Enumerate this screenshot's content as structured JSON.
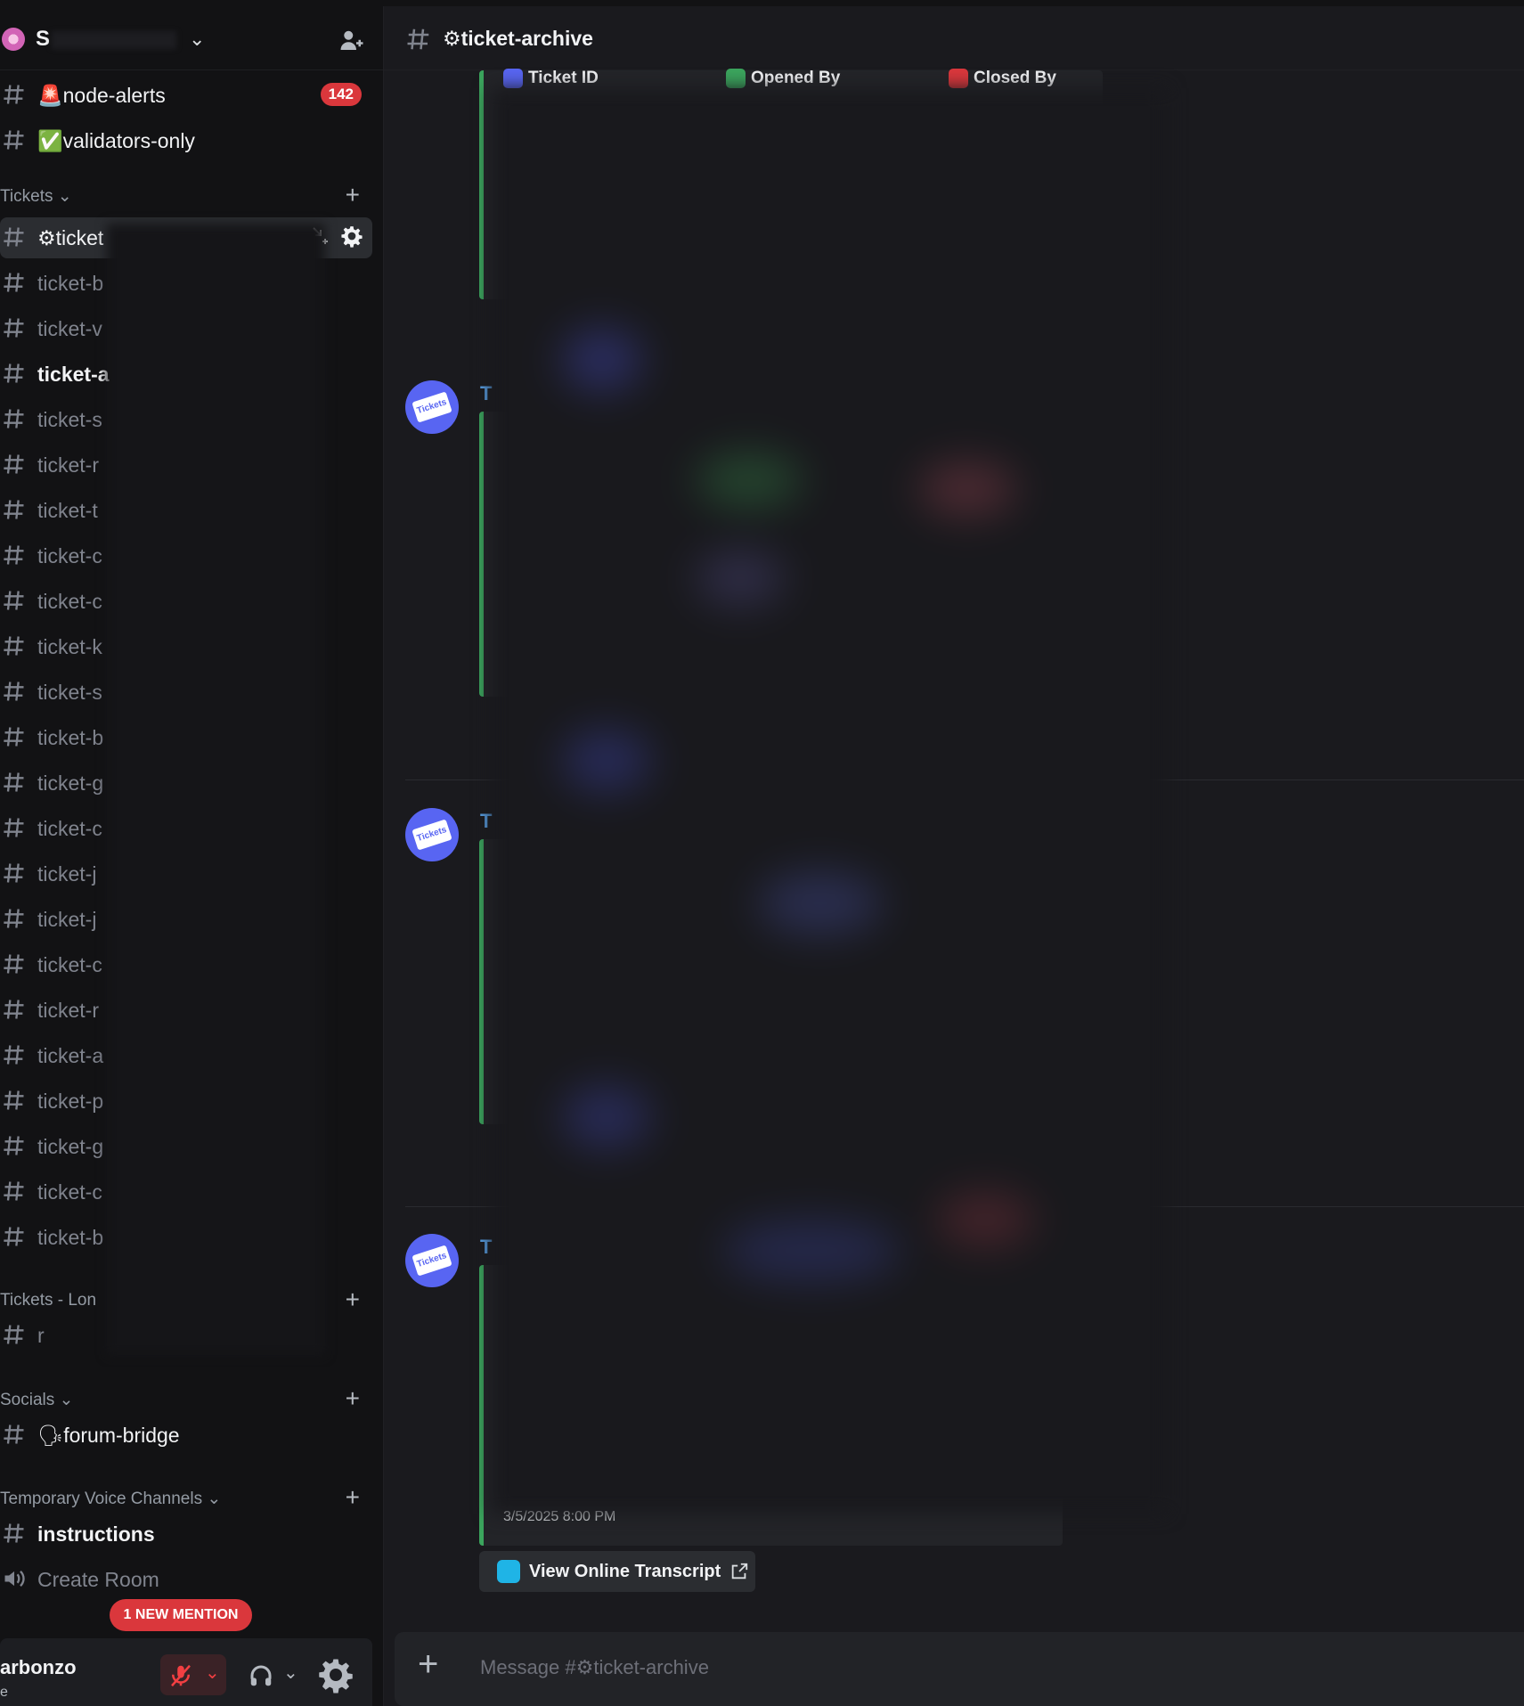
{
  "server": {
    "name": "S",
    "invite_label": "Invite People"
  },
  "top_channels": [
    {
      "emoji": "🚨",
      "label": "node-alerts",
      "badge": "142"
    },
    {
      "emoji": "✅",
      "label": "validators-only"
    }
  ],
  "categories": {
    "tickets": "Tickets",
    "tickets_long": "Tickets - Lon",
    "socials": "Socials",
    "temp_voice": "Temporary Voice Channels"
  },
  "ticket_channels": [
    {
      "label": "⚙ticket"
    },
    {
      "label": "ticket-b"
    },
    {
      "label": "ticket-v"
    },
    {
      "label": "ticket-a"
    },
    {
      "label": "ticket-s"
    },
    {
      "label": "ticket-r"
    },
    {
      "label": "ticket-t"
    },
    {
      "label": "ticket-c"
    },
    {
      "label": "ticket-c"
    },
    {
      "label": "ticket-k"
    },
    {
      "label": "ticket-s"
    },
    {
      "label": "ticket-b"
    },
    {
      "label": "ticket-g"
    },
    {
      "label": "ticket-c"
    },
    {
      "label": "ticket-j"
    },
    {
      "label": "ticket-j"
    },
    {
      "label": "ticket-c"
    },
    {
      "label": "ticket-r"
    },
    {
      "label": "ticket-a"
    },
    {
      "label": "ticket-p"
    },
    {
      "label": "ticket-g"
    },
    {
      "label": "ticket-c"
    },
    {
      "label": "ticket-b"
    }
  ],
  "long_channels": [
    {
      "label": "r"
    }
  ],
  "social_channels": [
    {
      "label": "🗣forum-bridge"
    }
  ],
  "voice_channels": [
    {
      "label": "instructions"
    },
    {
      "label": "Create Room"
    }
  ],
  "mention_pill": "1 NEW MENTION",
  "user": {
    "name": "arbonzo",
    "status": "e"
  },
  "header": {
    "title": "⚙ticket-archive"
  },
  "messages": [
    {
      "author": "T"
    },
    {
      "author": "T"
    },
    {
      "author": "T"
    }
  ],
  "embed_fields": [
    "Ticket ID",
    "Opened By",
    "Closed By"
  ],
  "embed_date": "3/5/2025 8:00 PM",
  "avatar_text": "Tickets",
  "transcript_button": "View Online Transcript",
  "composer": {
    "placeholder": "Message #⚙ticket-archive"
  },
  "colors": {
    "accent_green": "#3ba55d",
    "badge_red": "#da373c",
    "blurple": "#5865f2",
    "author_blue": "#5ba6ef"
  }
}
